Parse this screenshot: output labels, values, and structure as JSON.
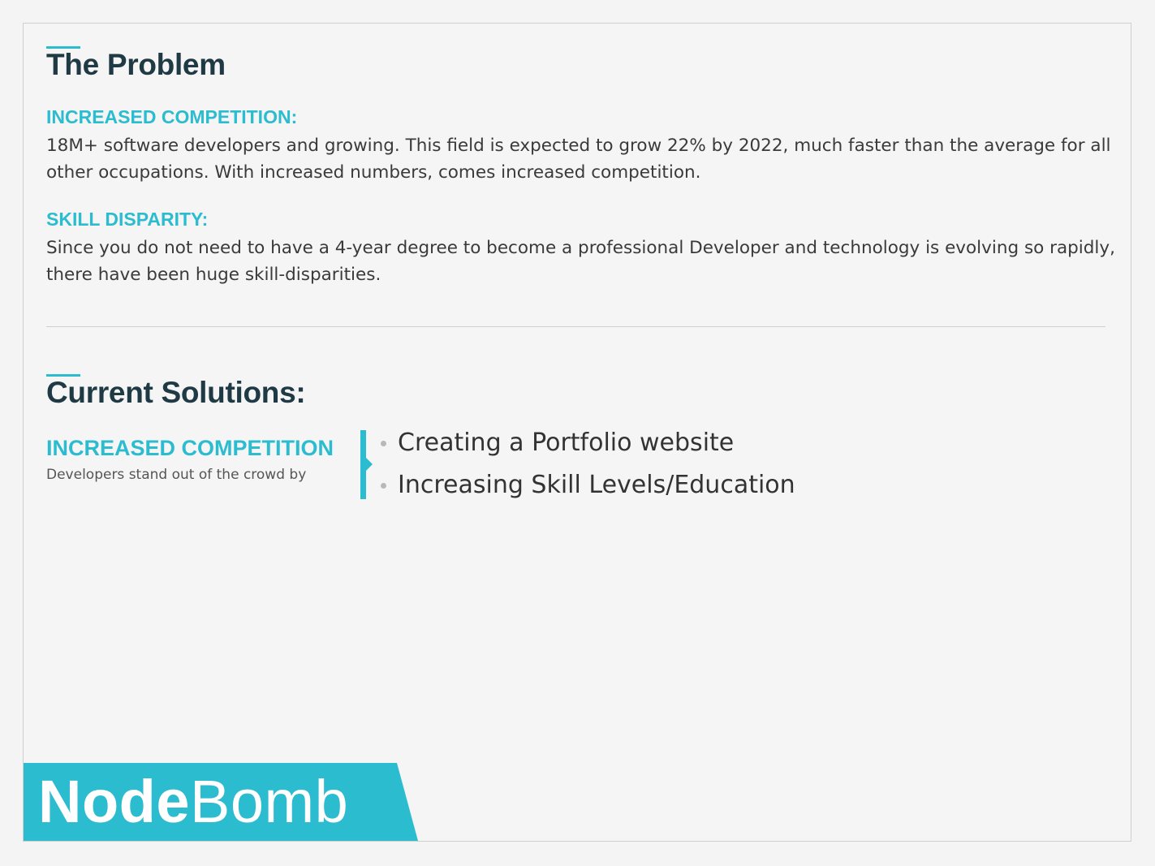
{
  "problem": {
    "title": "The Problem",
    "sections": [
      {
        "heading": "INCREASED COMPETITION:",
        "text": "18M+ software developers and growing. This field is expected to grow 22% by 2022, much faster than the average for all other occupations. With increased numbers, comes increased competition."
      },
      {
        "heading": "SKILL DISPARITY:",
        "text": "Since you do not need to have a 4-year degree to become a professional Developer and technology is evolving so rapidly, there have been huge skill-disparities."
      }
    ]
  },
  "solutions": {
    "title": "Current Solutions:",
    "label": "INCREASED COMPETITION",
    "caption": "Developers stand out of the crowd by",
    "items": [
      "Creating a Portfolio website",
      "Increasing Skill Levels/Education"
    ]
  },
  "logo": {
    "strong": "Node",
    "light": "Bomb"
  },
  "colors": {
    "accent": "#2bbccf",
    "heading": "#1f3a44",
    "body": "#3a3a3a"
  }
}
